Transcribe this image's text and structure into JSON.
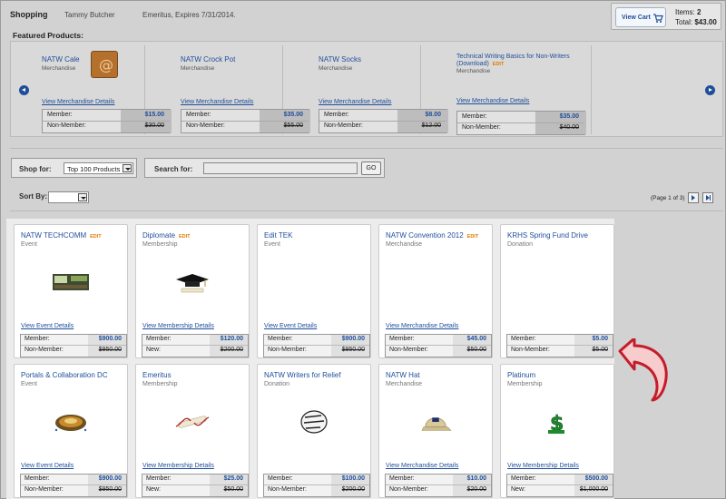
{
  "header": {
    "title": "Shopping",
    "user": "Tammy Butcher",
    "status": "Emeritus, Expires 7/31/2014.",
    "view_cart_label": "View Cart",
    "items_label": "Items:",
    "items_count": "2",
    "total_label": "Total:",
    "total_value": "$43.00"
  },
  "featured": {
    "title": "Featured Products:",
    "products": [
      {
        "name": "NATW Cale",
        "type": "Merchandise",
        "detail": "View Merchandise Details",
        "member_label": "Member:",
        "member_price": "$15.00",
        "nonmember_label": "Non-Member:",
        "nonmember_price": "$30.00"
      },
      {
        "name": "NATW Crock Pot",
        "type": "Merchandise",
        "detail": "View Merchandise Details",
        "member_label": "Member:",
        "member_price": "$35.00",
        "nonmember_label": "Non-Member:",
        "nonmember_price": "$55.00"
      },
      {
        "name": "NATW Socks",
        "type": "Merchandise",
        "detail": "View Merchandise Details",
        "member_label": "Member:",
        "member_price": "$8.00",
        "nonmember_label": "Non-Member:",
        "nonmember_price": "$12.00"
      },
      {
        "name": "Technical Writing Basics for Non-Writers (Download)",
        "edit": "EDIT",
        "type": "Merchandise",
        "detail": "View Merchandise Details",
        "member_label": "Member:",
        "member_price": "$35.00",
        "nonmember_label": "Non-Member:",
        "nonmember_price": "$40.00"
      }
    ]
  },
  "filters": {
    "shop_for_label": "Shop for:",
    "shop_for_value": "Top 100 Products",
    "search_for_label": "Search for:",
    "search_value": "",
    "go_label": "GO",
    "sort_by_label": "Sort By:",
    "sort_value": "",
    "page_info": "(Page 1 of 3)"
  },
  "products": [
    {
      "name": "NATW TECHCOMM",
      "edit": "EDIT",
      "type": "Event",
      "detail": "View Event Details",
      "l1": "Member:",
      "p1": "$900.00",
      "l2": "Non-Member:",
      "p2": "$950.00",
      "icon": "conference-room-icon"
    },
    {
      "name": "Diplomate",
      "edit": "EDIT",
      "type": "Membership",
      "detail": "View Membership Details",
      "l1": "Member:",
      "p1": "$120.00",
      "l2": "New:",
      "p2": "$200.00",
      "icon": "graduation-cap-icon"
    },
    {
      "name": "Edit TEK",
      "type": "Event",
      "detail": "View Event Details",
      "l1": "Member:",
      "p1": "$900.00",
      "l2": "Non-Member:",
      "p2": "$950.00",
      "icon": ""
    },
    {
      "name": "NATW Convention 2012",
      "edit": "EDIT",
      "type": "Merchandise",
      "detail": "View Merchandise Details",
      "l1": "Member:",
      "p1": "$45.00",
      "l2": "Non-Member:",
      "p2": "$50.00",
      "icon": ""
    },
    {
      "name": "KRHS Spring Fund Drive",
      "type": "Donation",
      "detail": "",
      "l1": "Member:",
      "p1": "$5.00",
      "l2": "Non-Member:",
      "p2": "$5.00",
      "icon": ""
    },
    {
      "name": "Portals & Collaboration DC",
      "type": "Event",
      "detail": "View Event Details",
      "l1": "Member:",
      "p1": "$900.00",
      "l2": "Non-Member:",
      "p2": "$950.00",
      "icon": "stadium-icon"
    },
    {
      "name": "Emeritus",
      "type": "Membership",
      "detail": "View Membership Details",
      "l1": "Member:",
      "p1": "$25.00",
      "l2": "New:",
      "p2": "$50.00",
      "icon": "diploma-ribbon-icon"
    },
    {
      "name": "NATW Writers for Relief",
      "type": "Donation",
      "detail": "",
      "l1": "Member:",
      "p1": "$100.00",
      "l2": "Non-Member:",
      "p2": "$200.00",
      "icon": "relief-fund-logo-icon"
    },
    {
      "name": "NATW Hat",
      "type": "Merchandise",
      "detail": "View Merchandise Details",
      "l1": "Member:",
      "p1": "$10.00",
      "l2": "Non-Member:",
      "p2": "$20.00",
      "icon": "cap-hat-icon"
    },
    {
      "name": "Platinum",
      "type": "Membership",
      "detail": "View Membership Details",
      "l1": "Member:",
      "p1": "$500.00",
      "l2": "New:",
      "p2": "$1,000.00",
      "icon": "dollar-sign-icon"
    }
  ]
}
